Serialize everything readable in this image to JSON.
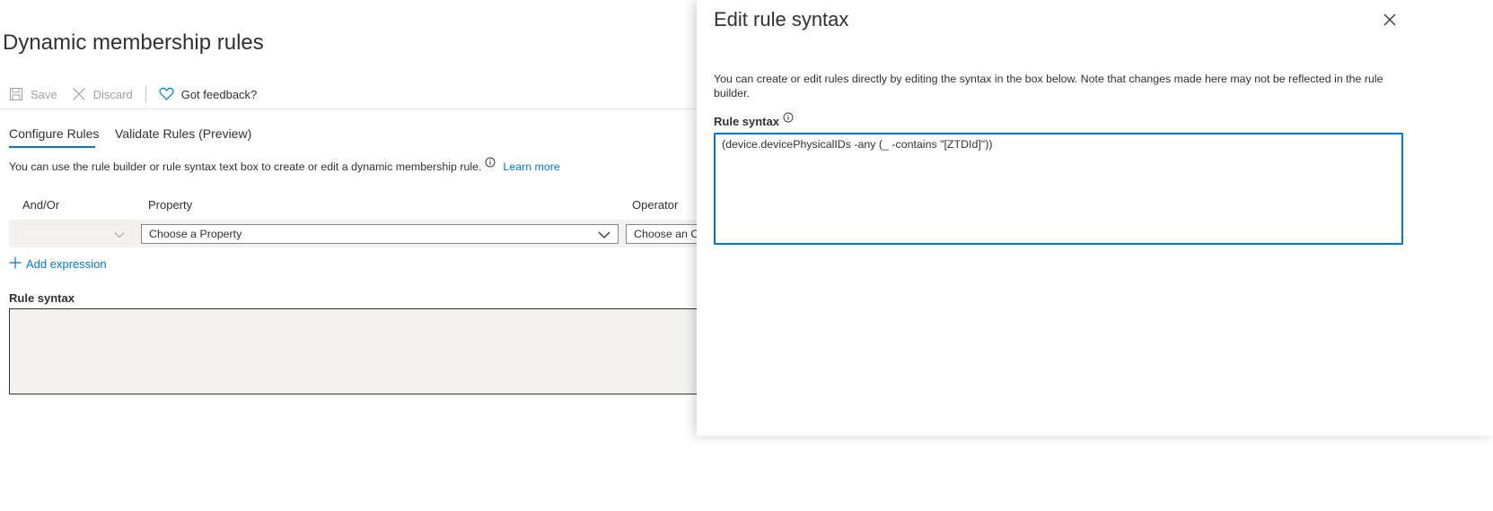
{
  "page": {
    "title": "Dynamic membership rules"
  },
  "toolbar": {
    "save_label": "Save",
    "discard_label": "Discard",
    "feedback_label": "Got feedback?"
  },
  "tabs": [
    {
      "label": "Configure Rules",
      "active": true
    },
    {
      "label": "Validate Rules (Preview)",
      "active": false
    }
  ],
  "help": {
    "text": "You can use the rule builder or rule syntax text box to create or edit a dynamic membership rule.",
    "link": "Learn more"
  },
  "rule_builder": {
    "columns": [
      "And/Or",
      "Property",
      "Operator"
    ],
    "row": {
      "andor_value": "",
      "property_placeholder": "Choose a Property",
      "operator_placeholder": "Choose an O"
    },
    "add_expression_label": "Add expression"
  },
  "rule_syntax": {
    "label": "Rule syntax",
    "value": ""
  },
  "panel": {
    "title": "Edit rule syntax",
    "description": "You can create or edit rules directly by editing the syntax in the box below. Note that changes made here may not be reflected in the rule builder.",
    "syntax_label": "Rule syntax",
    "syntax_value": "(device.devicePhysicalIDs -any (_ -contains \"[ZTDId]\"))"
  },
  "colors": {
    "accent": "#0078d4",
    "text": "#323130",
    "muted": "#605e5c",
    "band": "#f3f2f1"
  },
  "icons": {
    "save": "save-icon",
    "discard": "discard-x-icon",
    "feedback": "heart-icon",
    "info": "info-icon",
    "chevron": "chevron-down-icon",
    "add": "plus-icon",
    "close": "close-icon"
  }
}
